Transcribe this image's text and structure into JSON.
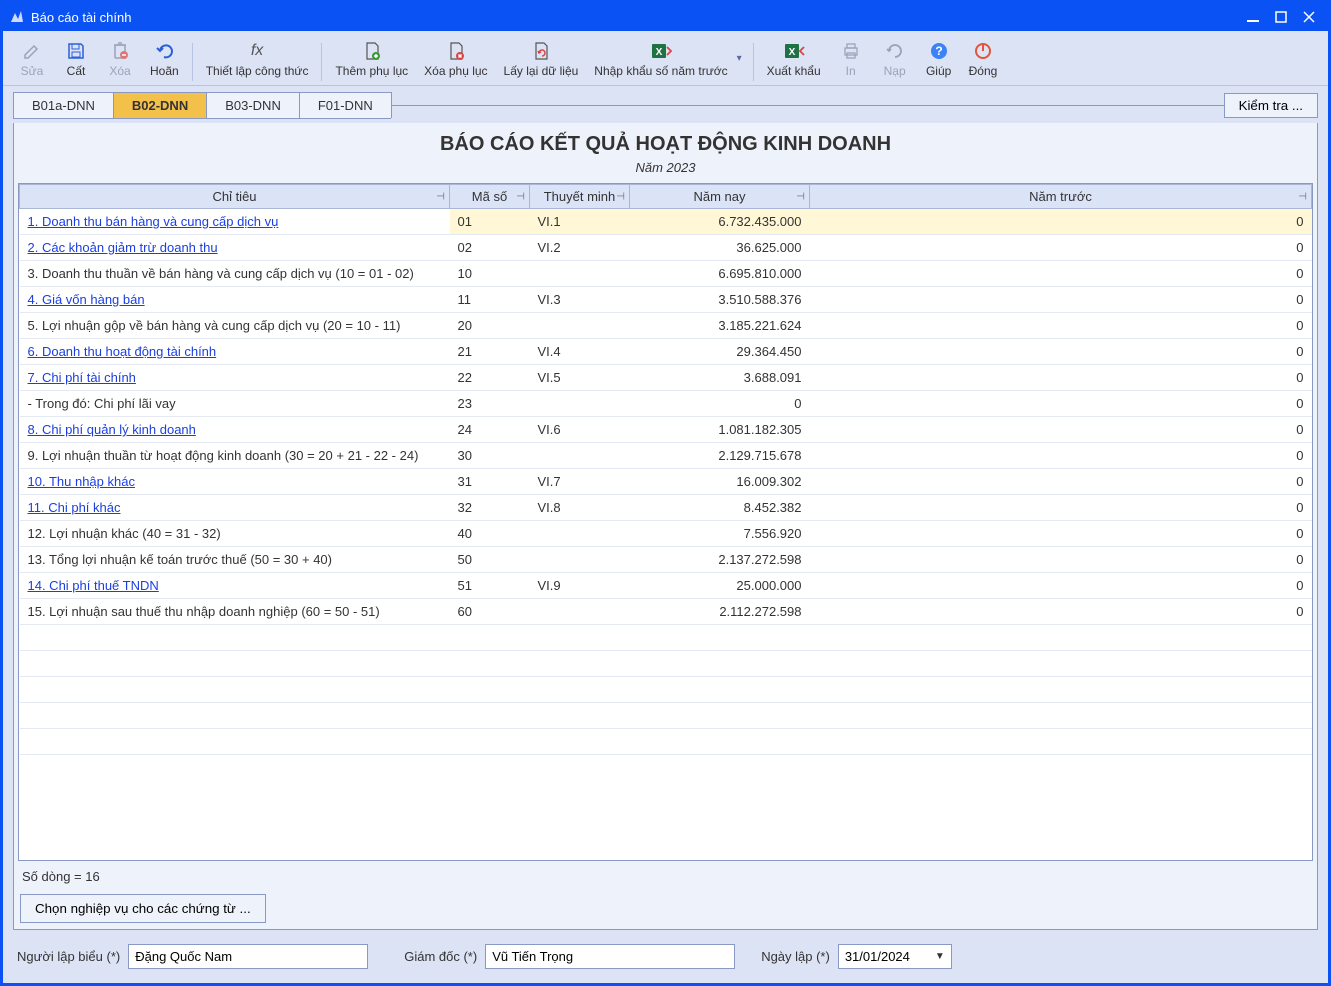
{
  "window": {
    "title": "Báo cáo tài chính"
  },
  "toolbar": {
    "sua": "Sửa",
    "cat": "Cất",
    "xoa": "Xóa",
    "hoan": "Hoãn",
    "tlct": "Thiết lập công thức",
    "tpl": "Thêm phụ lục",
    "xpl": "Xóa phụ lục",
    "lldl": "Lấy lại dữ liệu",
    "nksnt": "Nhập khẩu số năm trước",
    "xk": "Xuất khẩu",
    "in": "In",
    "nap": "Nạp",
    "giup": "Giúp",
    "dong": "Đóng"
  },
  "tabs": [
    "B01a-DNN",
    "B02-DNN",
    "B03-DNN",
    "F01-DNN"
  ],
  "kiemtra": "Kiểm tra ...",
  "report": {
    "title": "BÁO CÁO KẾT QUẢ HOẠT ĐỘNG KINH DOANH",
    "subtitle": "Năm 2023"
  },
  "headers": {
    "chitieu": "Chỉ tiêu",
    "maso": "Mã số",
    "tm": "Thuyết minh",
    "namnay": "Năm nay",
    "namtruoc": "Năm trước"
  },
  "rows": [
    {
      "ct": "1. Doanh thu bán hàng và cung cấp dịch vụ",
      "link": true,
      "ms": "01",
      "tm": "VI.1",
      "nn": "6.732.435.000",
      "nt": "0",
      "sel": true
    },
    {
      "ct": "2. Các khoản giảm trừ doanh thu",
      "link": true,
      "ms": "02",
      "tm": "VI.2",
      "nn": "36.625.000",
      "nt": "0"
    },
    {
      "ct": "3. Doanh thu thuần về bán hàng và cung cấp dịch vụ (10 = 01 - 02)",
      "ms": "10",
      "tm": "",
      "nn": "6.695.810.000",
      "nt": "0"
    },
    {
      "ct": "4. Giá vốn hàng bán",
      "link": true,
      "ms": "11",
      "tm": "VI.3",
      "nn": "3.510.588.376",
      "nt": "0"
    },
    {
      "ct": "5. Lợi nhuận gộp về bán hàng và cung cấp dịch vụ (20 = 10 - 11)",
      "ms": "20",
      "tm": "",
      "nn": "3.185.221.624",
      "nt": "0"
    },
    {
      "ct": "6. Doanh thu hoạt động tài chính",
      "link": true,
      "ms": "21",
      "tm": "VI.4",
      "nn": "29.364.450",
      "nt": "0"
    },
    {
      "ct": "7. Chi phí tài chính",
      "link": true,
      "ms": "22",
      "tm": "VI.5",
      "nn": "3.688.091",
      "nt": "0"
    },
    {
      "ct": " - Trong đó: Chi phí lãi vay",
      "ms": "23",
      "tm": "",
      "nn": "0",
      "nt": "0"
    },
    {
      "ct": "8. Chi phí quản lý kinh doanh",
      "link": true,
      "ms": "24",
      "tm": "VI.6",
      "nn": "1.081.182.305",
      "nt": "0"
    },
    {
      "ct": "9. Lợi nhuận thuần từ hoạt động kinh doanh (30 = 20 + 21 - 22 - 24)",
      "ms": "30",
      "tm": "",
      "nn": "2.129.715.678",
      "nt": "0"
    },
    {
      "ct": "10. Thu nhập khác",
      "link": true,
      "ms": "31",
      "tm": "VI.7",
      "nn": "16.009.302",
      "nt": "0"
    },
    {
      "ct": "11. Chi phí khác",
      "link": true,
      "ms": "32",
      "tm": "VI.8",
      "nn": "8.452.382",
      "nt": "0"
    },
    {
      "ct": "12. Lợi nhuận khác (40 = 31 - 32)",
      "ms": "40",
      "tm": "",
      "nn": "7.556.920",
      "nt": "0"
    },
    {
      "ct": "13. Tổng lợi nhuận kế toán trước thuế (50 = 30 + 40)",
      "ms": "50",
      "tm": "",
      "nn": "2.137.272.598",
      "nt": "0"
    },
    {
      "ct": "14. Chi phí thuế TNDN",
      "link": true,
      "ms": "51",
      "tm": "VI.9",
      "nn": "25.000.000",
      "nt": "0"
    },
    {
      "ct": "15. Lợi nhuận sau thuế thu nhập doanh nghiệp (60 = 50 - 51)",
      "ms": "60",
      "tm": "",
      "nn": "2.112.272.598",
      "nt": "0"
    }
  ],
  "row_count_label": "Số dòng = 16",
  "chonnv": "Chọn nghiệp vụ cho các chứng từ ...",
  "footer": {
    "nguoilap_label": "Người lập biểu (*)",
    "nguoilap": "Đặng Quốc Nam",
    "giamdoc_label": "Giám đốc (*)",
    "giamdoc": "Vũ Tiến Trọng",
    "ngaylap_label": "Ngày lập (*)",
    "ngaylap": "31/01/2024"
  }
}
